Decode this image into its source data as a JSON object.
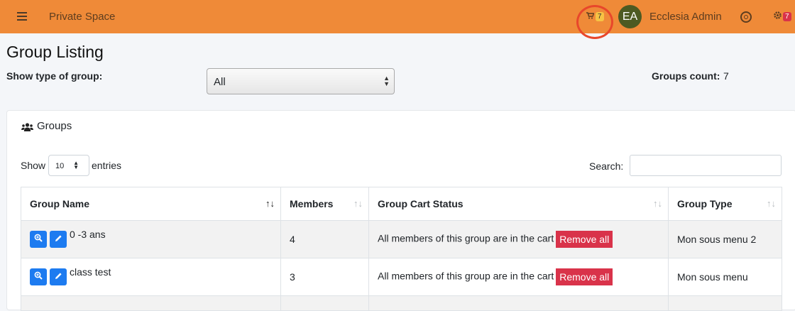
{
  "topbar": {
    "brand": "Private Space",
    "cart_count": "7",
    "avatar_initials": "EA",
    "user_name": "Ecclesia Admin",
    "notifications_count": "7"
  },
  "page": {
    "title": "Group Listing",
    "type_label": "Show type of group:",
    "type_selected": "All",
    "count_label": "Groups count:",
    "count_value": "7"
  },
  "card": {
    "title": "Groups",
    "show_label": "Show",
    "page_length": "10",
    "entries_label": "entries",
    "search_label": "Search:",
    "search_value": ""
  },
  "table": {
    "headers": [
      "Group Name",
      "Members",
      "Group Cart Status",
      "Group Type"
    ],
    "rows": [
      {
        "name": "0 -3 ans",
        "members": "4",
        "status": "All members of this group are in the cart",
        "action": "Remove all",
        "type": "Mon sous menu 2"
      },
      {
        "name": "class test",
        "members": "3",
        "status": "All members of this group are in the cart",
        "action": "Remove all",
        "type": "Mon sous menu"
      }
    ]
  },
  "colors": {
    "topbar": "#ef8a38",
    "primary_button": "#1d7bf0",
    "danger_button": "#d9334a",
    "annotation_circle": "#e8472b"
  },
  "icons": [
    "menu-icon",
    "cart-icon",
    "lifebuoy-icon",
    "gear-icon",
    "users-icon",
    "zoom-in-icon",
    "pencil-icon",
    "sort-icon"
  ]
}
